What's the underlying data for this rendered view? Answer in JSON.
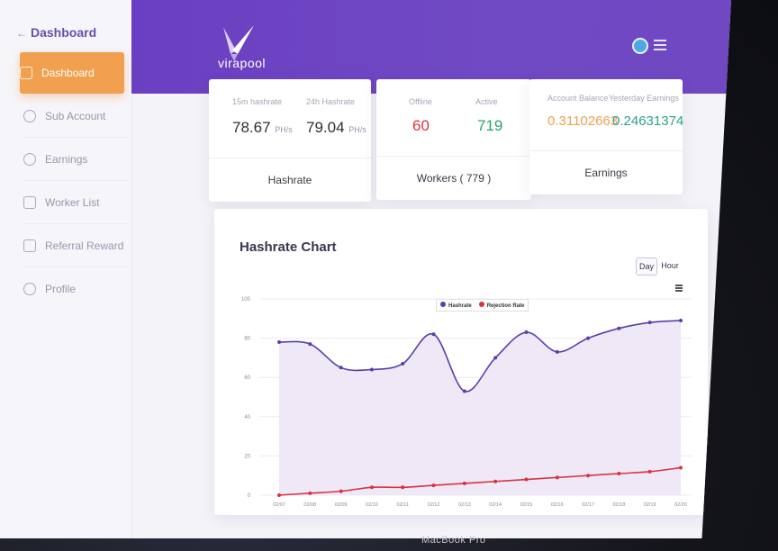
{
  "sidebar": {
    "title": "Dashboard",
    "items": [
      {
        "label": "Dashboard",
        "icon": "home-icon",
        "active": true
      },
      {
        "label": "Sub Account",
        "icon": "user-circle-icon",
        "active": false
      },
      {
        "label": "Earnings",
        "icon": "coin-icon",
        "active": false
      },
      {
        "label": "Worker List",
        "icon": "list-icon",
        "active": false
      },
      {
        "label": "Referral Reward",
        "icon": "gift-icon",
        "active": false
      },
      {
        "label": "Profile",
        "icon": "profile-icon",
        "active": false
      }
    ]
  },
  "header": {
    "brand": "virapool",
    "accent": "#6b3fc2"
  },
  "cards": {
    "hashrate": {
      "l1": "15m hashrate",
      "v1": "78.67",
      "u1": "PH/s",
      "l2": "24h Hashrate",
      "v2": "79.04",
      "u2": "PH/s",
      "footer": "Hashrate"
    },
    "workers": {
      "l1": "Offline",
      "v1": "60",
      "l2": "Active",
      "v2": "719",
      "footer": "Workers ( 779 )"
    },
    "earnings": {
      "l1": "Account Balance",
      "v1": "0.31102663",
      "l2": "Yesterday Earnings",
      "v2": "0.24631374",
      "footer": "Earnings"
    }
  },
  "chart_panel": {
    "title": "Hashrate Chart",
    "btn_day": "Day",
    "btn_hour": "Hour"
  },
  "chart_data": {
    "type": "line",
    "x": [
      "02/07",
      "02/08",
      "02/09",
      "02/10",
      "02/11",
      "02/12",
      "02/13",
      "02/14",
      "02/15",
      "02/16",
      "02/17",
      "02/18",
      "02/19",
      "02/20"
    ],
    "ylim": [
      0,
      100
    ],
    "yticks": [
      "0",
      "20",
      "40",
      "60",
      "80",
      "100"
    ],
    "grid": true,
    "legend": "top-center",
    "series": [
      {
        "name": "Hashrate",
        "color": "#5b3ea8",
        "values": [
          78,
          77,
          65,
          64,
          67,
          82,
          53,
          70,
          83,
          73,
          80,
          85,
          88,
          89
        ]
      },
      {
        "name": "Rejection Rate",
        "color": "#d8343f",
        "values": [
          0,
          1,
          2,
          4,
          4,
          5,
          6,
          7,
          8,
          9,
          10,
          11,
          12,
          14
        ]
      }
    ]
  },
  "laptop_label": "MacBook Pro"
}
